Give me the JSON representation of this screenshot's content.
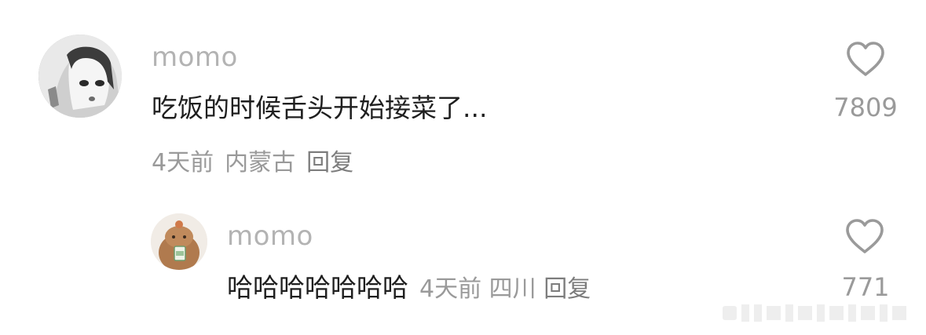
{
  "comments": [
    {
      "username": "momo",
      "text": "吃饭的时候舌头开始接菜了...",
      "time": "4天前",
      "location": "内蒙古",
      "reply_label": "回复",
      "likes": "7809",
      "avatar_icon": "avatar-icon"
    }
  ],
  "replies": [
    {
      "username": "momo",
      "text": "哈哈哈哈哈哈哈",
      "time": "4天前",
      "location": "四川",
      "reply_label": "回复",
      "likes": "771",
      "avatar_icon": "avatar-icon"
    }
  ],
  "icons": {
    "like": "heart-outline-icon"
  },
  "colors": {
    "username": "#b3b3b3",
    "text": "#1f1f1f",
    "meta": "#9a9a9a",
    "heart_stroke": "#9a9a9a"
  }
}
